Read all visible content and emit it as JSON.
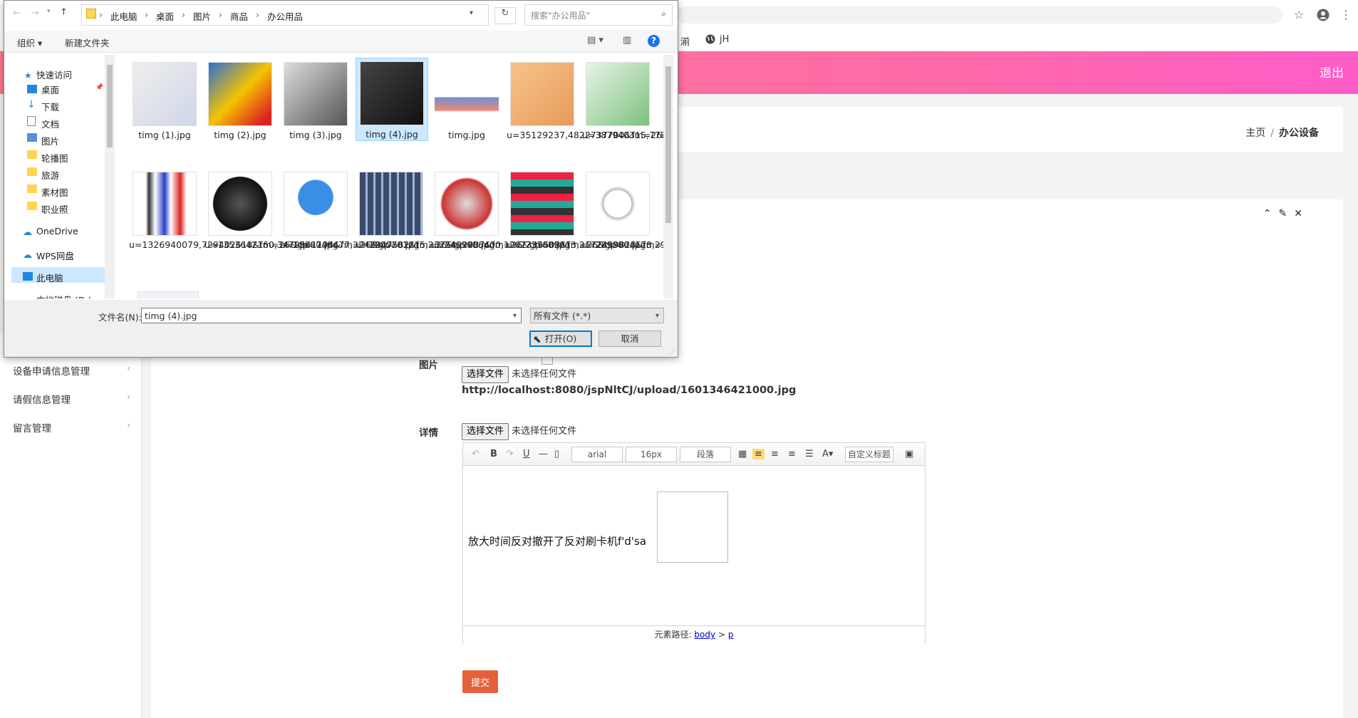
{
  "browser": {
    "bookmark_1": "湔",
    "bookmark_2": "jH",
    "star_icon": "☆"
  },
  "app": {
    "logout": "退出",
    "breadcrumb_home": "主页",
    "breadcrumb_sep": "/",
    "breadcrumb_current": "办公设备",
    "accent": "#ff6aa9"
  },
  "sidebar": {
    "items": [
      {
        "label": "设备申请信息管理"
      },
      {
        "label": "请假信息管理"
      },
      {
        "label": "留言管理"
      }
    ]
  },
  "form": {
    "image_label": "图片",
    "choose_file": "选择文件",
    "no_file": "未选择任何文件",
    "image_url": "http://localhost:8080/jspNltCJ/upload/1601346421000.jpg",
    "detail_label": "详情",
    "submit": "提交",
    "submit_color": "#e5613b"
  },
  "editor": {
    "font": "arial",
    "size": "16px",
    "paragraph": "段落",
    "custom_title": "自定义标题",
    "content": "放大时间反对撤开了反对刷卡机f'd'sa",
    "path_label": "元素路径:",
    "path_body": "body",
    "path_gt": ">",
    "path_p": "p"
  },
  "dialog": {
    "path": [
      "此电脑",
      "桌面",
      "图片",
      "商品",
      "办公用品"
    ],
    "search_placeholder": "搜索\"办公用品\"",
    "organize": "组织",
    "new_folder": "新建文件夹",
    "tree": [
      {
        "label": "快速访问"
      },
      {
        "label": "桌面"
      },
      {
        "label": "下载"
      },
      {
        "label": "文档"
      },
      {
        "label": "图片"
      },
      {
        "label": "轮播图"
      },
      {
        "label": "旅游"
      },
      {
        "label": "素材图"
      },
      {
        "label": "职业照"
      },
      {
        "label": "OneDrive"
      },
      {
        "label": "WPS网盘"
      },
      {
        "label": "此电脑"
      },
      {
        "label": "本地磁盘 (D:)"
      }
    ],
    "files": [
      {
        "name": "timg (1).jpg"
      },
      {
        "name": "timg (2).jpg"
      },
      {
        "name": "timg (3).jpg"
      },
      {
        "name": "timg (4).jpg"
      },
      {
        "name": "timg.jpg"
      },
      {
        "name": "u=35129237,4822737700&fm=26&gp=0.jpg"
      },
      {
        "name": "u=387940315,7781396138&fm=26&gp=0.jpg"
      },
      {
        "name": "u=1326940079,729402618&fm=26&gp=0.jpg"
      },
      {
        "name": "u=1353642160,3479541194&fm=26&gp=0.jpg"
      },
      {
        "name": "u=1868748477,3243847582&fm=26&gp=0.jpg"
      },
      {
        "name": "u=1900261215,2325422087&fm=26&gp=0.jpg"
      },
      {
        "name": "u=2469956400,1207336508&fm=26&gp=0.jpg"
      },
      {
        "name": "u=2733889913,2172459828&fm=26&gp=0.jpg"
      },
      {
        "name": "u=2898864128,2998378916&fm=26&gp=0.jpg"
      }
    ],
    "filename_label": "文件名(N):",
    "filename_value": "timg (4).jpg",
    "filetype": "所有文件 (*.*)",
    "open": "打开(O)",
    "cancel": "取消"
  }
}
